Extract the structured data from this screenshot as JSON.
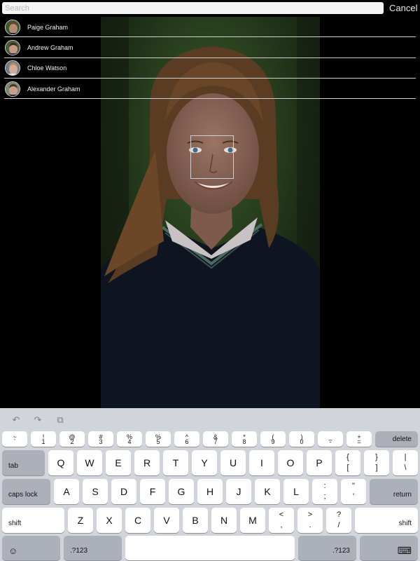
{
  "search": {
    "placeholder": "Search",
    "value": "",
    "cancel_label": "Cancel"
  },
  "suggestions": [
    {
      "name": "Paige Graham"
    },
    {
      "name": "Andrew Graham"
    },
    {
      "name": "Chloe Watson"
    },
    {
      "name": "Alexander Graham"
    }
  ],
  "keyboard": {
    "shortcuts": {
      "undo": "↶",
      "redo": "↷",
      "paste": "⧉"
    },
    "number_row": [
      {
        "top": "~",
        "bottom": "`"
      },
      {
        "top": "!",
        "bottom": "1"
      },
      {
        "top": "@",
        "bottom": "2"
      },
      {
        "top": "#",
        "bottom": "3"
      },
      {
        "top": "%",
        "bottom": "4"
      },
      {
        "top": "%",
        "bottom": "5"
      },
      {
        "top": "^",
        "bottom": "6"
      },
      {
        "top": "&",
        "bottom": "7"
      },
      {
        "top": "*",
        "bottom": "8"
      },
      {
        "top": "(",
        "bottom": "9"
      },
      {
        "top": ")",
        "bottom": "0"
      },
      {
        "top": "_",
        "bottom": "-"
      },
      {
        "top": "+",
        "bottom": "="
      }
    ],
    "delete_label": "delete",
    "tab_label": "tab",
    "row1_letters": [
      "Q",
      "W",
      "E",
      "R",
      "T",
      "Y",
      "U",
      "I",
      "O",
      "P"
    ],
    "row1_symbols": [
      {
        "top": "{",
        "bottom": "["
      },
      {
        "top": "}",
        "bottom": "]"
      },
      {
        "top": "|",
        "bottom": "\\"
      }
    ],
    "caps_label": "caps lock",
    "row2_letters": [
      "A",
      "S",
      "D",
      "F",
      "G",
      "H",
      "J",
      "K",
      "L"
    ],
    "row2_symbols": [
      {
        "top": ":",
        "bottom": ";"
      },
      {
        "top": "\"",
        "bottom": "'"
      }
    ],
    "return_label": "return",
    "shift_label": "shift",
    "row3_letters": [
      "Z",
      "X",
      "C",
      "V",
      "B",
      "N",
      "M"
    ],
    "row3_symbols": [
      {
        "top": "<",
        "bottom": ","
      },
      {
        "top": ">",
        "bottom": "."
      },
      {
        "top": "?",
        "bottom": "/"
      }
    ],
    "emoji_label": "☺",
    "numbers_label": ".?123",
    "hide_keyboard_label": "⌨"
  }
}
